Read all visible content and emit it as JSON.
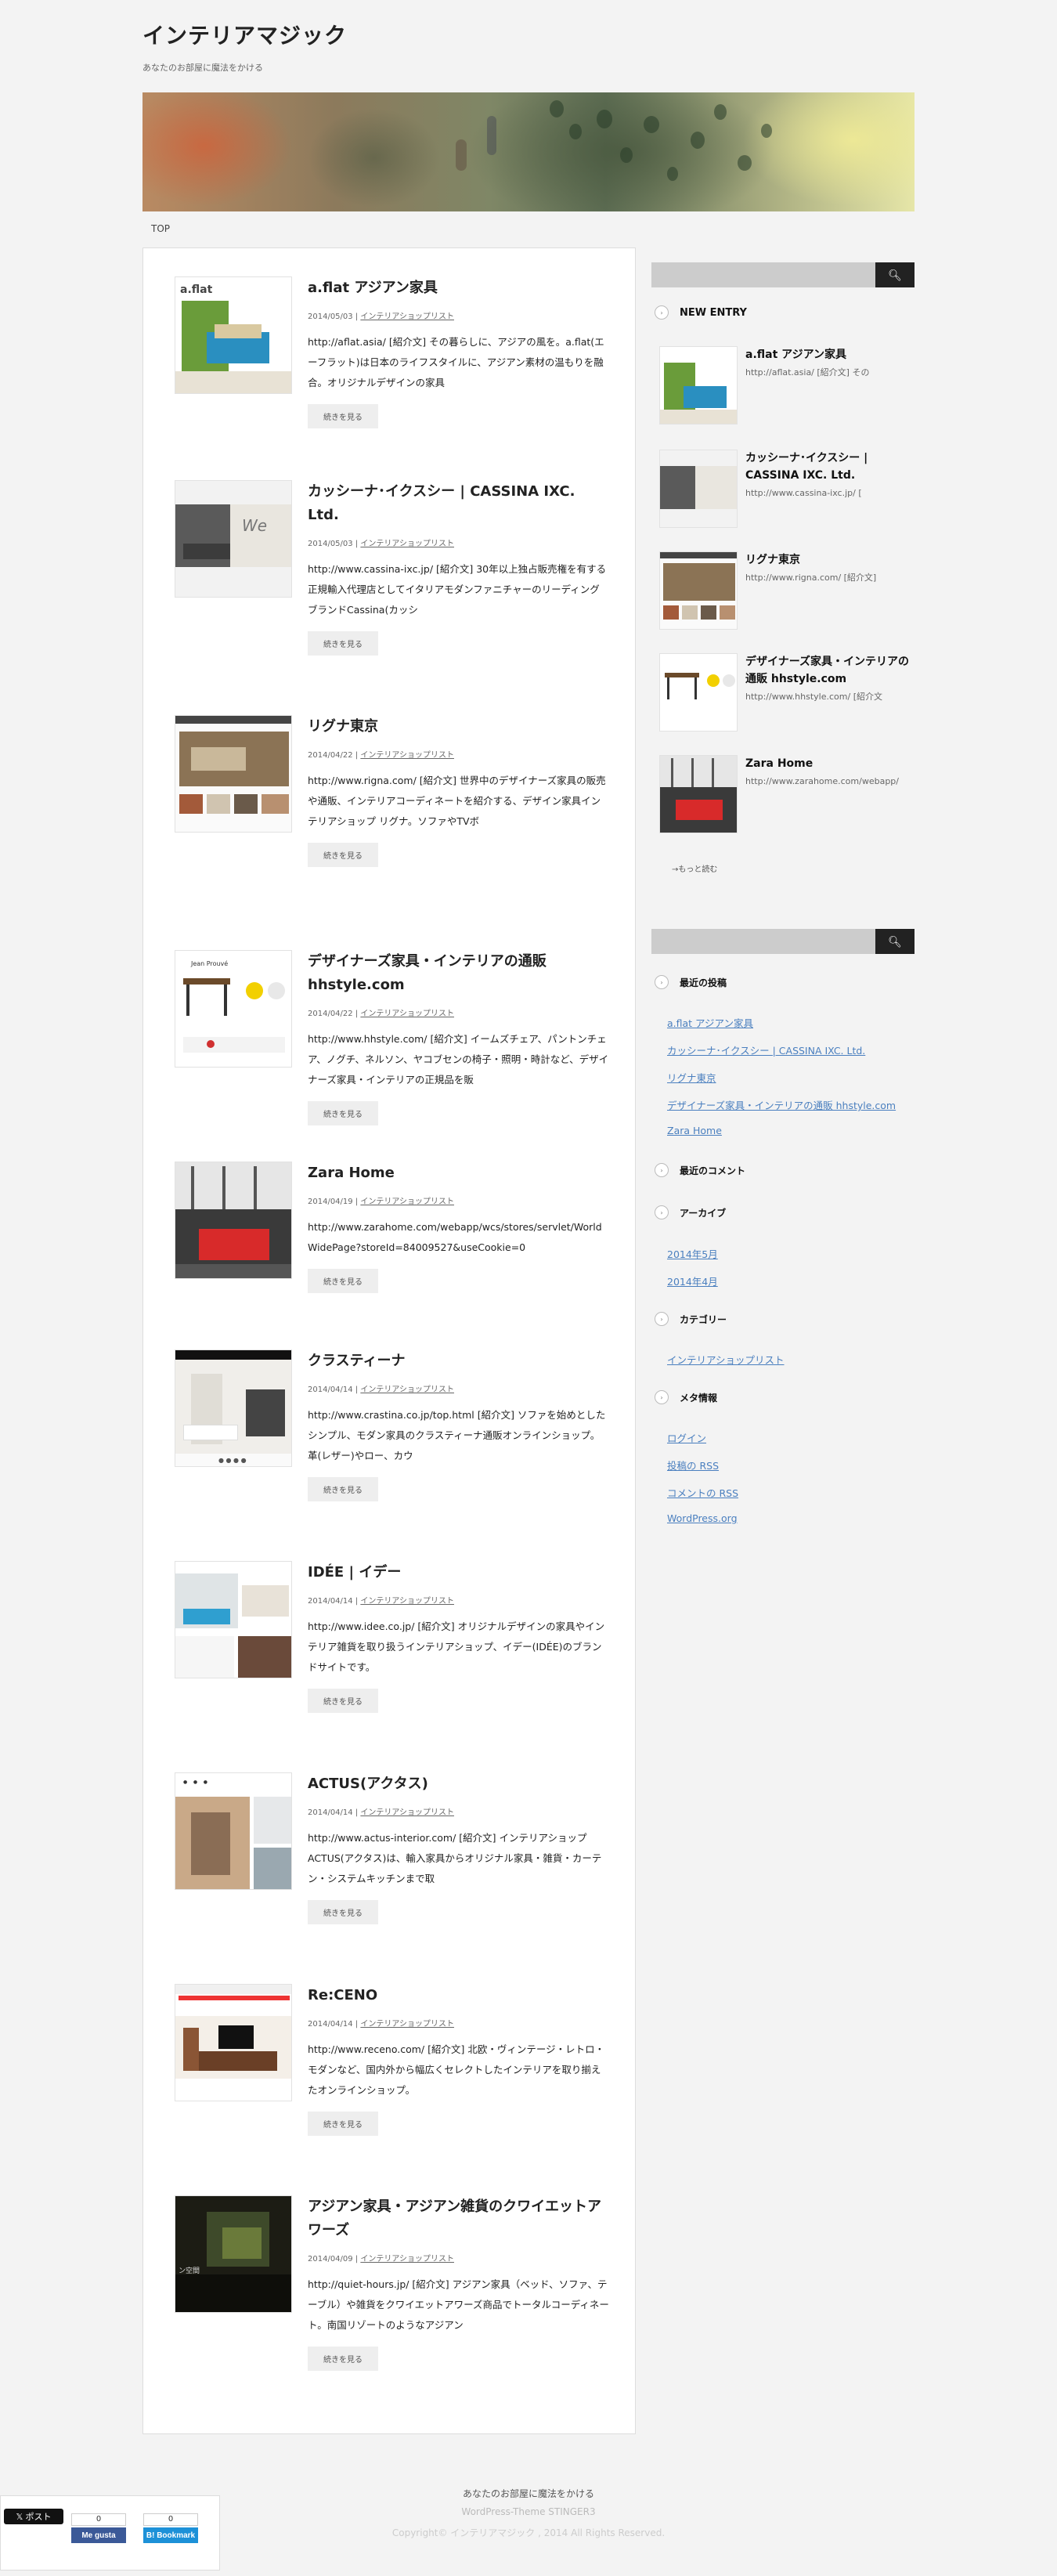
{
  "site": {
    "title": "インテリアマジック",
    "description": "あなたのお部屋に魔法をかける"
  },
  "breadcrumb": {
    "top": "TOP"
  },
  "posts": [
    {
      "title": "a.flat アジアン家具",
      "date": "2014/05/03",
      "category": "インテリアショップリスト",
      "excerpt": "http://aflat.asia/ [紹介文] その暮らしに、アジアの風を。a.flat(エーフラット)は日本のライフスタイルに、アジアン素材の温もりを融合。オリジナルデザインの家具",
      "more": "続きを見る"
    },
    {
      "title": "カッシーナ･イクスシー | CASSINA IXC. Ltd.",
      "date": "2014/05/03",
      "category": "インテリアショップリスト",
      "excerpt": "http://www.cassina-ixc.jp/ [紹介文] 30年以上独占販売権を有する正規輸入代理店としてイタリアモダンファニチャーのリーディングブランドCassina(カッシ",
      "more": "続きを見る"
    },
    {
      "title": "リグナ東京",
      "date": "2014/04/22",
      "category": "インテリアショップリスト",
      "excerpt": "http://www.rigna.com/ [紹介文] 世界中のデザイナーズ家具の販売や通販、インテリアコーディネートを紹介する、デザイン家具インテリアショップ リグナ。ソファやTVボ",
      "more": "続きを見る"
    },
    {
      "title": "デザイナーズ家具・インテリアの通販 hhstyle.com",
      "date": "2014/04/22",
      "category": "インテリアショップリスト",
      "excerpt": "http://www.hhstyle.com/ [紹介文] イームズチェア、パントンチェア、ノグチ、ネルソン、ヤコブセンの椅子・照明・時計など、デザイナーズ家具・インテリアの正規品を販",
      "more": "続きを見る"
    },
    {
      "title": "Zara Home",
      "date": "2014/04/19",
      "category": "インテリアショップリスト",
      "excerpt": "http://www.zarahome.com/webapp/wcs/stores/servlet/WorldWidePage?storeId=84009527&useCookie=0",
      "more": "続きを見る"
    },
    {
      "title": "クラスティーナ",
      "date": "2014/04/14",
      "category": "インテリアショップリスト",
      "excerpt": "http://www.crastina.co.jp/top.html [紹介文] ソファを始めとしたシンプル、モダン家具のクラスティーナ通販オンラインショップ。革(レザー)やロー、カウ",
      "more": "続きを見る"
    },
    {
      "title": "IDÉE | イデー",
      "date": "2014/04/14",
      "category": "インテリアショップリスト",
      "excerpt": "http://www.idee.co.jp/ [紹介文] オリジナルデザインの家具やインテリア雑貨を取り扱うインテリアショップ、イデー(IDÉE)のブランドサイトです。",
      "more": "続きを見る"
    },
    {
      "title": "ACTUS(アクタス)",
      "date": "2014/04/14",
      "category": "インテリアショップリスト",
      "excerpt": "http://www.actus-interior.com/ [紹介文] インテリアショップACTUS(アクタス)は、輸入家具からオリジナル家具・雑貨・カーテン・システムキッチンまで取",
      "more": "続きを見る"
    },
    {
      "title": "Re:CENO",
      "date": "2014/04/14",
      "category": "インテリアショップリスト",
      "excerpt": "http://www.receno.com/ [紹介文] 北欧・ヴィンテージ・レトロ・モダンなど、国内外から幅広くセレクトしたインテリアを取り揃えたオンラインショップ。",
      "more": "続きを見る"
    },
    {
      "title": "アジアン家具・アジアン雑貨のクワイエットアワーズ",
      "date": "2014/04/09",
      "category": "インテリアショップリスト",
      "excerpt": "http://quiet-hours.jp/ [紹介文] アジアン家具（ベッド、ソファ、テーブル）や雑貨をクワイエットアワーズ商品でトータルコーディネート。南国リゾートのようなアジアン",
      "more": "続きを見る"
    }
  ],
  "sidebar": {
    "search_placeholder": "",
    "search_icon": "magnifier-icon",
    "new_entry_title": "NEW ENTRY",
    "entries": [
      {
        "title": "a.flat アジアン家具",
        "excerpt": "http://aflat.asia/ [紹介文] その"
      },
      {
        "title": "カッシーナ･イクスシー | CASSINA IXC. Ltd.",
        "excerpt": "http://www.cassina-ixc.jp/ ["
      },
      {
        "title": "リグナ東京",
        "excerpt": "http://www.rigna.com/ [紹介文]"
      },
      {
        "title": "デザイナーズ家具・インテリアの通販 hhstyle.com",
        "excerpt": "http://www.hhstyle.com/ [紹介文"
      },
      {
        "title": "Zara Home",
        "excerpt": "http://www.zarahome.com/webapp/"
      }
    ],
    "more_link": "→もっと読む",
    "recent_posts_title": "最近の投稿",
    "recent_posts": [
      "a.flat アジアン家具",
      "カッシーナ･イクスシー | CASSINA IXC. Ltd.",
      "リグナ東京",
      "デザイナーズ家具・インテリアの通販 hhstyle.com",
      "Zara Home"
    ],
    "recent_comments_title": "最近のコメント",
    "archives_title": "アーカイブ",
    "archives": [
      "2014年5月",
      "2014年4月"
    ],
    "categories_title": "カテゴリー",
    "categories": [
      "インテリアショップリスト"
    ],
    "meta_title": "メタ情報",
    "meta": [
      "ログイン",
      "投稿の RSS",
      "コメントの RSS",
      "WordPress.org"
    ]
  },
  "footer": {
    "line1": "あなたのお部屋に魔法をかける",
    "line2": "WordPress-Theme STINGER3",
    "line3": "Copyright© インテリアマジック , 2014 All Rights Reserved."
  },
  "share": {
    "twitter_label": "𝕏 ポスト",
    "fb_count": "0",
    "fb_label": "Me gusta",
    "hb_count": "0",
    "hb_label": "B! Bookmark"
  },
  "colors": {
    "background": "#f3f3f3",
    "link": "#4a7fbf",
    "search_button": "#222222",
    "facebook": "#3b5998",
    "hatena": "#1d91d8"
  }
}
